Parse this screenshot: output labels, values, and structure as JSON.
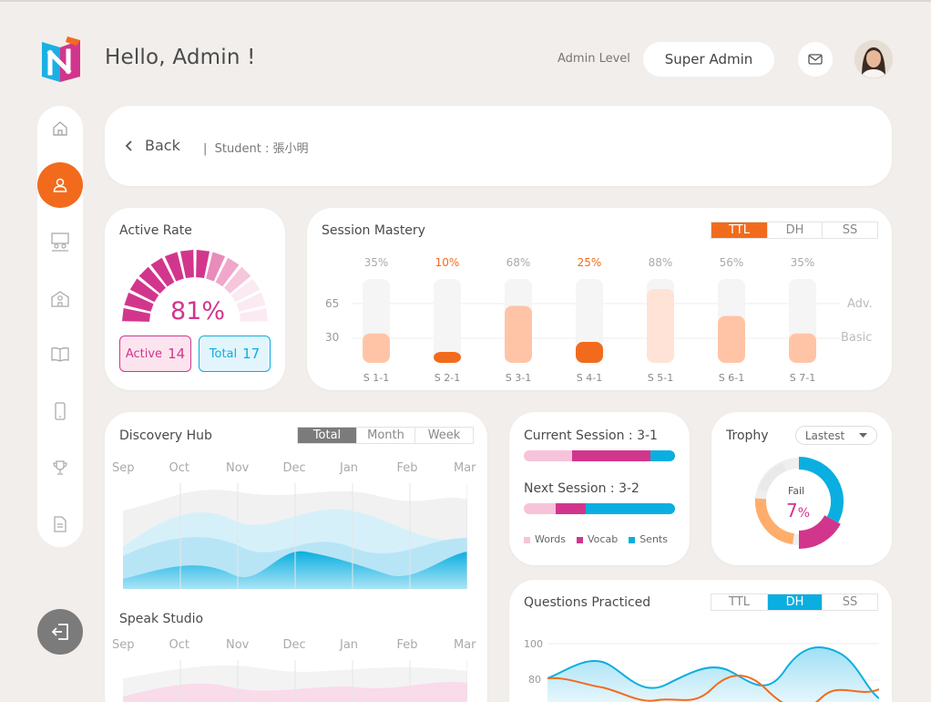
{
  "header": {
    "greeting": "Hello, Admin !",
    "admin_level_label": "Admin Level",
    "admin_level_value": "Super Admin"
  },
  "icons": {
    "logo": "book-n-logo",
    "mail": "mail-icon",
    "avatar": "user-avatar"
  },
  "sidebar": {
    "items": [
      {
        "name": "home",
        "icon": "home-icon"
      },
      {
        "name": "student",
        "icon": "user-icon",
        "active": true
      },
      {
        "name": "classroom",
        "icon": "classroom-icon"
      },
      {
        "name": "school",
        "icon": "school-icon"
      },
      {
        "name": "library",
        "icon": "book-icon"
      },
      {
        "name": "device",
        "icon": "phone-icon"
      },
      {
        "name": "trophy",
        "icon": "trophy-icon"
      },
      {
        "name": "report",
        "icon": "document-icon"
      }
    ],
    "logout_icon": "logout-icon"
  },
  "breadcrumb": {
    "back_label": "Back",
    "separator": "|",
    "student_label": "Student : 張小明"
  },
  "active_rate": {
    "title": "Active Rate",
    "value": "81%",
    "percent": 81,
    "active_label": "Active",
    "active_count": "14",
    "total_label": "Total",
    "total_count": "17"
  },
  "session_mastery": {
    "title": "Session Mastery",
    "tabs": [
      "TTL",
      "DH",
      "SS"
    ],
    "selected_tab": "TTL",
    "y_labels": [
      "65",
      "30"
    ],
    "levels": [
      "Adv.",
      "Basic"
    ],
    "sessions": [
      {
        "label": "S 1-1",
        "pct": "35%",
        "value": 35,
        "highlight": false
      },
      {
        "label": "S 2-1",
        "pct": "10%",
        "value": 10,
        "highlight": true
      },
      {
        "label": "S 3-1",
        "pct": "68%",
        "value": 68,
        "highlight": false
      },
      {
        "label": "S 4-1",
        "pct": "25%",
        "value": 25,
        "highlight": true
      },
      {
        "label": "S 5-1",
        "pct": "88%",
        "value": 88,
        "highlight": false
      },
      {
        "label": "S 6-1",
        "pct": "56%",
        "value": 56,
        "highlight": false
      },
      {
        "label": "S 7-1",
        "pct": "35%",
        "value": 35,
        "highlight": false
      }
    ]
  },
  "discovery_hub": {
    "title": "Discovery Hub",
    "tabs": [
      "Total",
      "Month",
      "Week"
    ],
    "selected_tab": "Total",
    "months": [
      "Sep",
      "Oct",
      "Nov",
      "Dec",
      "Jan",
      "Feb",
      "Mar"
    ]
  },
  "speak_studio": {
    "title": "Speak Studio",
    "months": [
      "Sep",
      "Oct",
      "Nov",
      "Dec",
      "Jan",
      "Feb",
      "Mar"
    ]
  },
  "current_session": {
    "title": "Current Session : 3-1",
    "next_title": "Next Session : 3-2",
    "legend": [
      "Words",
      "Vocab",
      "Sents"
    ],
    "current_split": [
      0.32,
      0.52,
      0.16
    ],
    "next_split": [
      0.21,
      0.2,
      0.59
    ]
  },
  "trophy": {
    "title": "Trophy",
    "dropdown": "Lastest",
    "center_label": "Fail",
    "center_value": "7",
    "center_unit": "%"
  },
  "questions": {
    "title": "Questions Practiced",
    "tabs": [
      "TTL",
      "DH",
      "SS"
    ],
    "selected_tab": "DH",
    "y_labels": [
      "100",
      "80"
    ]
  },
  "colors": {
    "accent": "#f26b1d",
    "pink": "#d2368c",
    "blue": "#0baee0",
    "peach": "#ffc4a6",
    "light_pink": "#f5c6dc"
  }
}
